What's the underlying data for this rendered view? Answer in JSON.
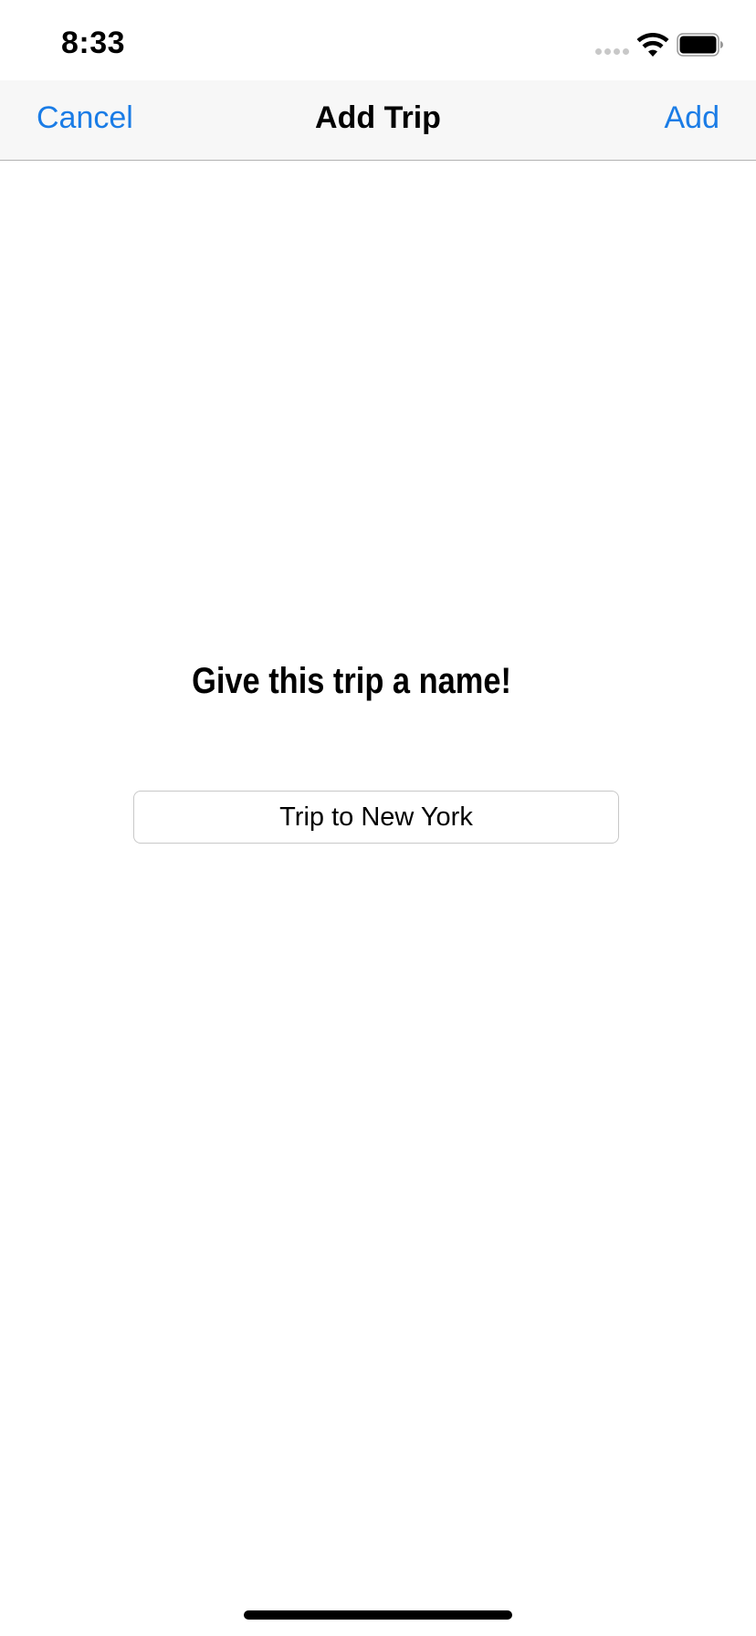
{
  "status_bar": {
    "time": "8:33",
    "icons": [
      "signal-icon",
      "wifi-icon",
      "battery-icon"
    ]
  },
  "nav": {
    "cancel_label": "Cancel",
    "title": "Add Trip",
    "add_label": "Add"
  },
  "form": {
    "heading": "Give this trip a name!",
    "name_value": "Trip to New York"
  },
  "colors": {
    "accent": "#1a7ce6",
    "nav_background": "#f7f7f7",
    "caret": "#3b67d9"
  }
}
